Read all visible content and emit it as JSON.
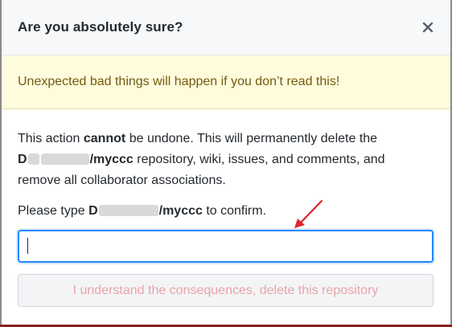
{
  "dialog": {
    "title": "Are you absolutely sure?",
    "close_icon": "close-icon"
  },
  "warning": {
    "text": "Unexpected bad things will happen if you don’t read this!"
  },
  "body": {
    "line1_pre": "This action ",
    "line1_bold": "cannot",
    "line1_post": " be undone. This will permanently delete the",
    "repo_owner_prefix": "D",
    "repo_name_suffix": "/myccc",
    "line2_post": " repository, wiki, issues, and comments, and",
    "line3": "remove all collaborator associations."
  },
  "confirm": {
    "prompt_pre": "Please type ",
    "repo_owner_prefix": "D",
    "repo_name_suffix": "/myccc",
    "prompt_post": " to confirm.",
    "input_value": "",
    "input_placeholder": ""
  },
  "delete_button": {
    "label": "I understand the consequences, delete this repository",
    "state": "disabled"
  },
  "colors": {
    "warning_bg": "#fffbdd",
    "warning_text": "#735c0f",
    "input_focus_border": "#2188ff",
    "danger_disabled_text": "#e9a3a9",
    "annotation_arrow": "#e0242e"
  }
}
